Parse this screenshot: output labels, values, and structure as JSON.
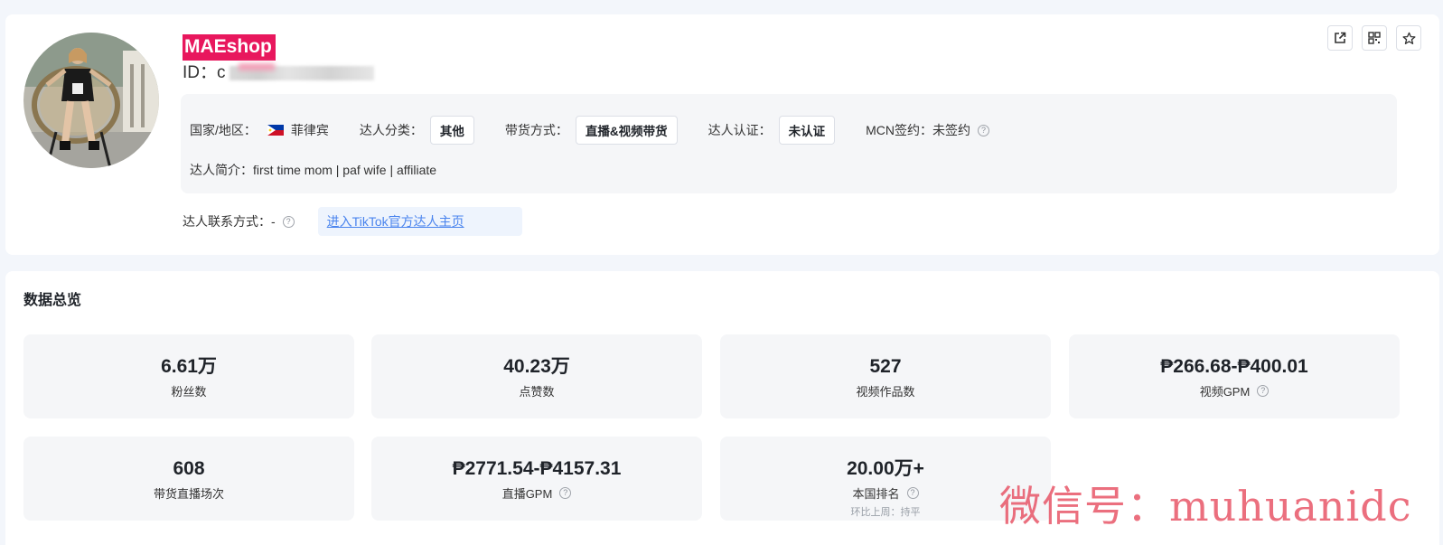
{
  "profile": {
    "shop_name": "MAEshop",
    "id_label": "ID：c",
    "country_label": "国家/地区：",
    "country_value": "菲律宾",
    "category_label": "达人分类：",
    "category_value": "其他",
    "sales_method_label": "带货方式：",
    "sales_method_value": "直播&视频带货",
    "verification_label": "达人认证：",
    "verification_value": "未认证",
    "mcn_label": "MCN签约：未签约",
    "bio": "达人简介：first time mom | paf wife | affiliate",
    "contact_label": "达人联系方式：-",
    "tiktok_link": "进入TikTok官方达人主页"
  },
  "overview": {
    "title": "数据总览",
    "stats": [
      {
        "value": "6.61万",
        "label": "粉丝数"
      },
      {
        "value": "40.23万",
        "label": "点赞数"
      },
      {
        "value": "527",
        "label": "视频作品数"
      },
      {
        "value": "₱266.68-₱400.01",
        "label": "视频GPM"
      },
      {
        "value": "608",
        "label": "带货直播场次"
      },
      {
        "value": "₱2771.54-₱4157.31",
        "label": "直播GPM"
      },
      {
        "value": "20.00万+",
        "label": "本国排名",
        "sub": "环比上周：持平"
      }
    ]
  },
  "watermark": "微信号：muhuanidc",
  "icons": [
    "external-link-icon",
    "qrcode-icon",
    "star-icon",
    "help-icon",
    "philippines-flag-icon"
  ],
  "colors": {
    "accent": "#e8175d",
    "link": "#4a84ee",
    "panel": "#f5f6f8"
  }
}
